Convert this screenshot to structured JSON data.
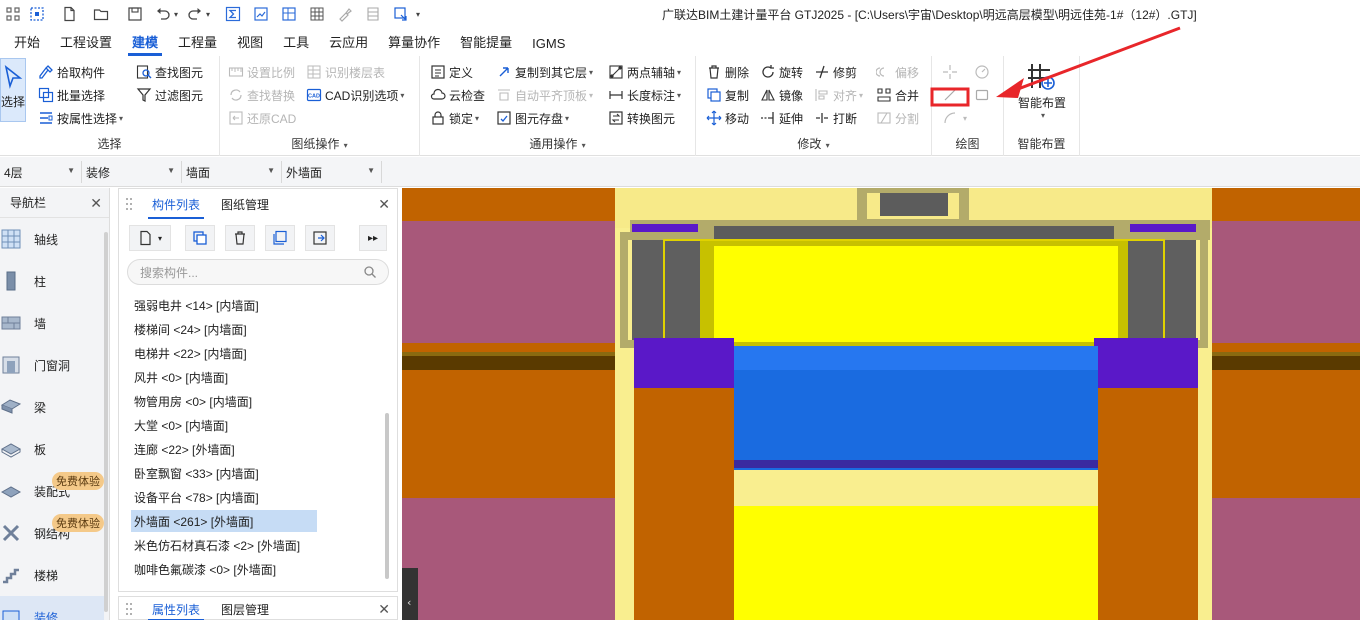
{
  "window": {
    "title": "广联达BIM土建计量平台 GTJ2025 - [C:\\Users\\宇宙\\Desktop\\明远高层模型\\明远佳苑-1#（12#）.GTJ]"
  },
  "menu": {
    "tabs": [
      "开始",
      "工程设置",
      "建模",
      "工程量",
      "视图",
      "工具",
      "云应用",
      "算量协作",
      "智能提量",
      "IGMS"
    ],
    "active": "建模"
  },
  "ribbon": {
    "select_group": {
      "label": "选择",
      "select_button": "选择",
      "pick": "拾取构件",
      "batch": "批量选择",
      "by_attr": "按属性选择",
      "find": "查找图元",
      "filter": "过滤图元"
    },
    "drawing_group": {
      "label": "图纸操作",
      "set_scale": "设置比例",
      "recognize_floor": "识别楼层表",
      "find_replace": "查找替换",
      "cad_options": "CAD识别选项",
      "restore_cad": "还原CAD"
    },
    "common_group": {
      "label": "通用操作",
      "define": "定义",
      "copy_floor": "复制到其它层",
      "two_point_axis": "两点辅轴",
      "cloud_check": "云检查",
      "auto_align": "自动平齐顶板",
      "length_mark": "长度标注",
      "lock": "锁定",
      "save_elem": "图元存盘",
      "convert_elem": "转换图元"
    },
    "modify_group": {
      "label": "修改",
      "delete": "删除",
      "rotate": "旋转",
      "trim": "修剪",
      "offset": "偏移",
      "copy": "复制",
      "mirror": "镜像",
      "align": "对齐",
      "merge": "合并",
      "move": "移动",
      "extend": "延伸",
      "break": "打断",
      "split": "分割"
    },
    "draw_group": {
      "label": "绘图"
    },
    "smart_group": {
      "label": "智能布置",
      "button": "智能布置"
    }
  },
  "filters": {
    "floor": "4层",
    "category": "装修",
    "type": "墙面",
    "component": "外墙面"
  },
  "navigator": {
    "title": "导航栏",
    "items": [
      {
        "label": "轴线"
      },
      {
        "label": "柱"
      },
      {
        "label": "墙"
      },
      {
        "label": "门窗洞"
      },
      {
        "label": "梁"
      },
      {
        "label": "板"
      },
      {
        "label": "装配式",
        "badge": "免费体验"
      },
      {
        "label": "钢结构",
        "badge": "免费体验"
      },
      {
        "label": "楼梯"
      },
      {
        "label": "装修"
      }
    ]
  },
  "component_panel": {
    "tabs": [
      "构件列表",
      "图纸管理"
    ],
    "search_placeholder": "搜索构件...",
    "items": [
      "强弱电井 <14> [内墙面]",
      "楼梯间 <24> [内墙面]",
      "电梯井 <22> [内墙面]",
      "风井 <0> [内墙面]",
      "物管用房 <0> [内墙面]",
      "大堂 <0> [内墙面]",
      "连廊 <22> [外墙面]",
      "卧室飘窗 <33> [内墙面]",
      "设备平台 <78> [内墙面]",
      "外墙面 <261> [外墙面]",
      "米色仿石材真石漆 <2> [外墙面]",
      "咖啡色氟碳漆 <0> [外墙面]"
    ],
    "selected_index": 9
  },
  "property_panel": {
    "tabs": [
      "属性列表",
      "图层管理"
    ]
  },
  "colors": {
    "accent": "#1a5fd6",
    "canvas_orange": "#c16300",
    "canvas_magenta": "#a8587a",
    "annotation_red": "#e8262a"
  }
}
